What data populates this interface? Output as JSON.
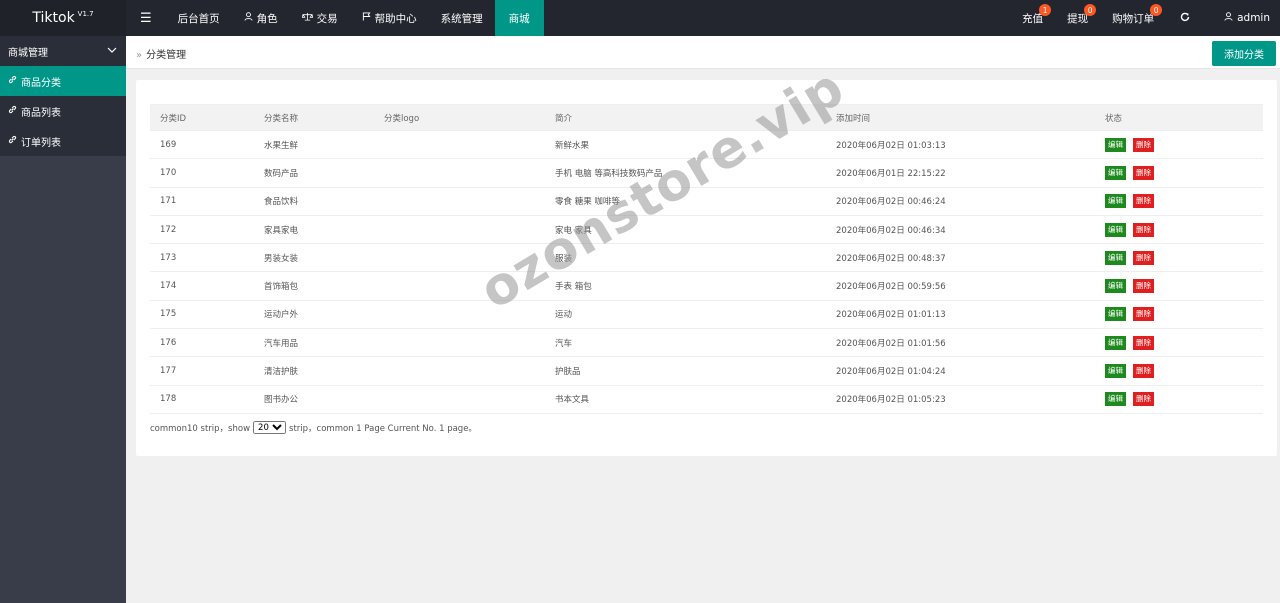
{
  "app": {
    "name": "Tiktok",
    "version": "V1.7"
  },
  "topnav": {
    "toggle": "☰",
    "items": [
      {
        "label": "后台首页",
        "icon": ""
      },
      {
        "label": "角色",
        "icon": "user-icon"
      },
      {
        "label": "交易",
        "icon": "scale-icon"
      },
      {
        "label": "帮助中心",
        "icon": "flag-icon"
      },
      {
        "label": "系统管理",
        "icon": ""
      },
      {
        "label": "商城",
        "icon": "",
        "active": true
      }
    ]
  },
  "rightnav": {
    "recharge": {
      "label": "充值",
      "badge": "1"
    },
    "withdraw": {
      "label": "提现",
      "badge": "0"
    },
    "orders": {
      "label": "购物订单",
      "badge": "0"
    },
    "refresh_icon": "refresh-icon",
    "user": "admin"
  },
  "sidebar": {
    "header": "商城管理",
    "items": [
      {
        "label": "商品分类",
        "active": true
      },
      {
        "label": "商品列表"
      },
      {
        "label": "订单列表"
      }
    ]
  },
  "breadcrumb": "分类管理",
  "add_button": "添加分类",
  "table": {
    "headers": [
      "分类ID",
      "分类名称",
      "分类logo",
      "简介",
      "添加时间",
      "状态"
    ],
    "rows": [
      {
        "id": "169",
        "name": "水果生鲜",
        "logo": "",
        "desc": "新鲜水果",
        "time": "2020年06月02日 01:03:13"
      },
      {
        "id": "170",
        "name": "数码产品",
        "logo": "",
        "desc": "手机 电脑 等高科技数码产品",
        "time": "2020年06月01日 22:15:22"
      },
      {
        "id": "171",
        "name": "食品饮料",
        "logo": "",
        "desc": "零食 糖果 咖啡等",
        "time": "2020年06月02日 00:46:24"
      },
      {
        "id": "172",
        "name": "家具家电",
        "logo": "",
        "desc": "家电 家具",
        "time": "2020年06月02日 00:46:34"
      },
      {
        "id": "173",
        "name": "男装女装",
        "logo": "",
        "desc": "服装",
        "time": "2020年06月02日 00:48:37"
      },
      {
        "id": "174",
        "name": "首饰箱包",
        "logo": "",
        "desc": "手表 箱包",
        "time": "2020年06月02日 00:59:56"
      },
      {
        "id": "175",
        "name": "运动户外",
        "logo": "",
        "desc": "运动",
        "time": "2020年06月02日 01:01:13"
      },
      {
        "id": "176",
        "name": "汽车用品",
        "logo": "",
        "desc": "汽车",
        "time": "2020年06月02日 01:01:56"
      },
      {
        "id": "177",
        "name": "清洁护肤",
        "logo": "",
        "desc": "护肤品",
        "time": "2020年06月02日 01:04:24"
      },
      {
        "id": "178",
        "name": "图书办公",
        "logo": "",
        "desc": "书本文具",
        "time": "2020年06月02日 01:05:23"
      }
    ],
    "edit_label": "编辑",
    "delete_label": "删除"
  },
  "pager": {
    "prefix": "common10 strip，show",
    "page_size": "20",
    "suffix": "strip，common 1 Page Current No. 1 page。"
  },
  "watermark": "ozonstore.vip",
  "colors": {
    "accent": "#009688",
    "topbar": "#23262e",
    "sidebar": "#393d49",
    "edit": "#1e8a1e",
    "delete": "#e02020",
    "badge": "#ff5722"
  }
}
